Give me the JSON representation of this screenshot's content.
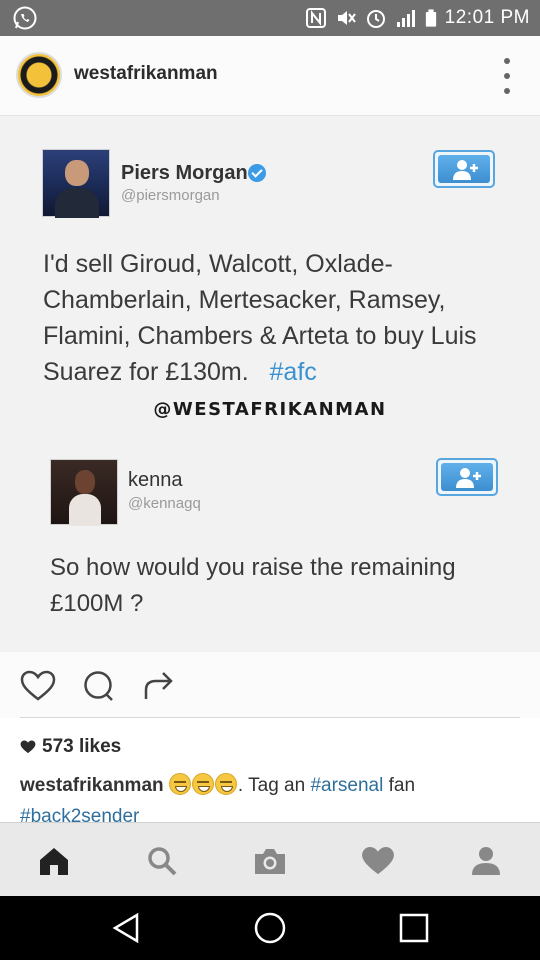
{
  "status_bar": {
    "time": "12:01 PM",
    "icons": [
      "whatsapp-icon",
      "nfc-icon",
      "mute-icon",
      "alarm-icon",
      "signal-icon",
      "battery-icon"
    ]
  },
  "post": {
    "username": "westafrikanman",
    "likes": "573 likes",
    "caption": {
      "username": "westafrikanman",
      "text": ". Tag an",
      "hashtag1": "#arsenal",
      "text2": "fan",
      "hashtag2": "#back2sender"
    }
  },
  "tweet1": {
    "name": "Piers Morgan",
    "handle": "@piersmorgan",
    "lines": [
      "I'd sell Giroud, Walcott, Oxlade-",
      "Chamberlain, Mertesacker, Ramsey,",
      "Flamini, Chambers & Arteta to buy Luis",
      "Suarez for £130m."
    ],
    "hashtag": "#afc"
  },
  "watermark": "@WESTAFRIKANMAN",
  "tweet2": {
    "name": "kenna",
    "handle": "@kennagq",
    "lines": [
      "So how would you raise the remaining",
      "£100M ?"
    ]
  },
  "colors": {
    "status_bar": "#6f6f6f",
    "link": "#3a91cf",
    "follow_button": "#4a9fdc",
    "bottom_nav": "#e9e9e9"
  }
}
